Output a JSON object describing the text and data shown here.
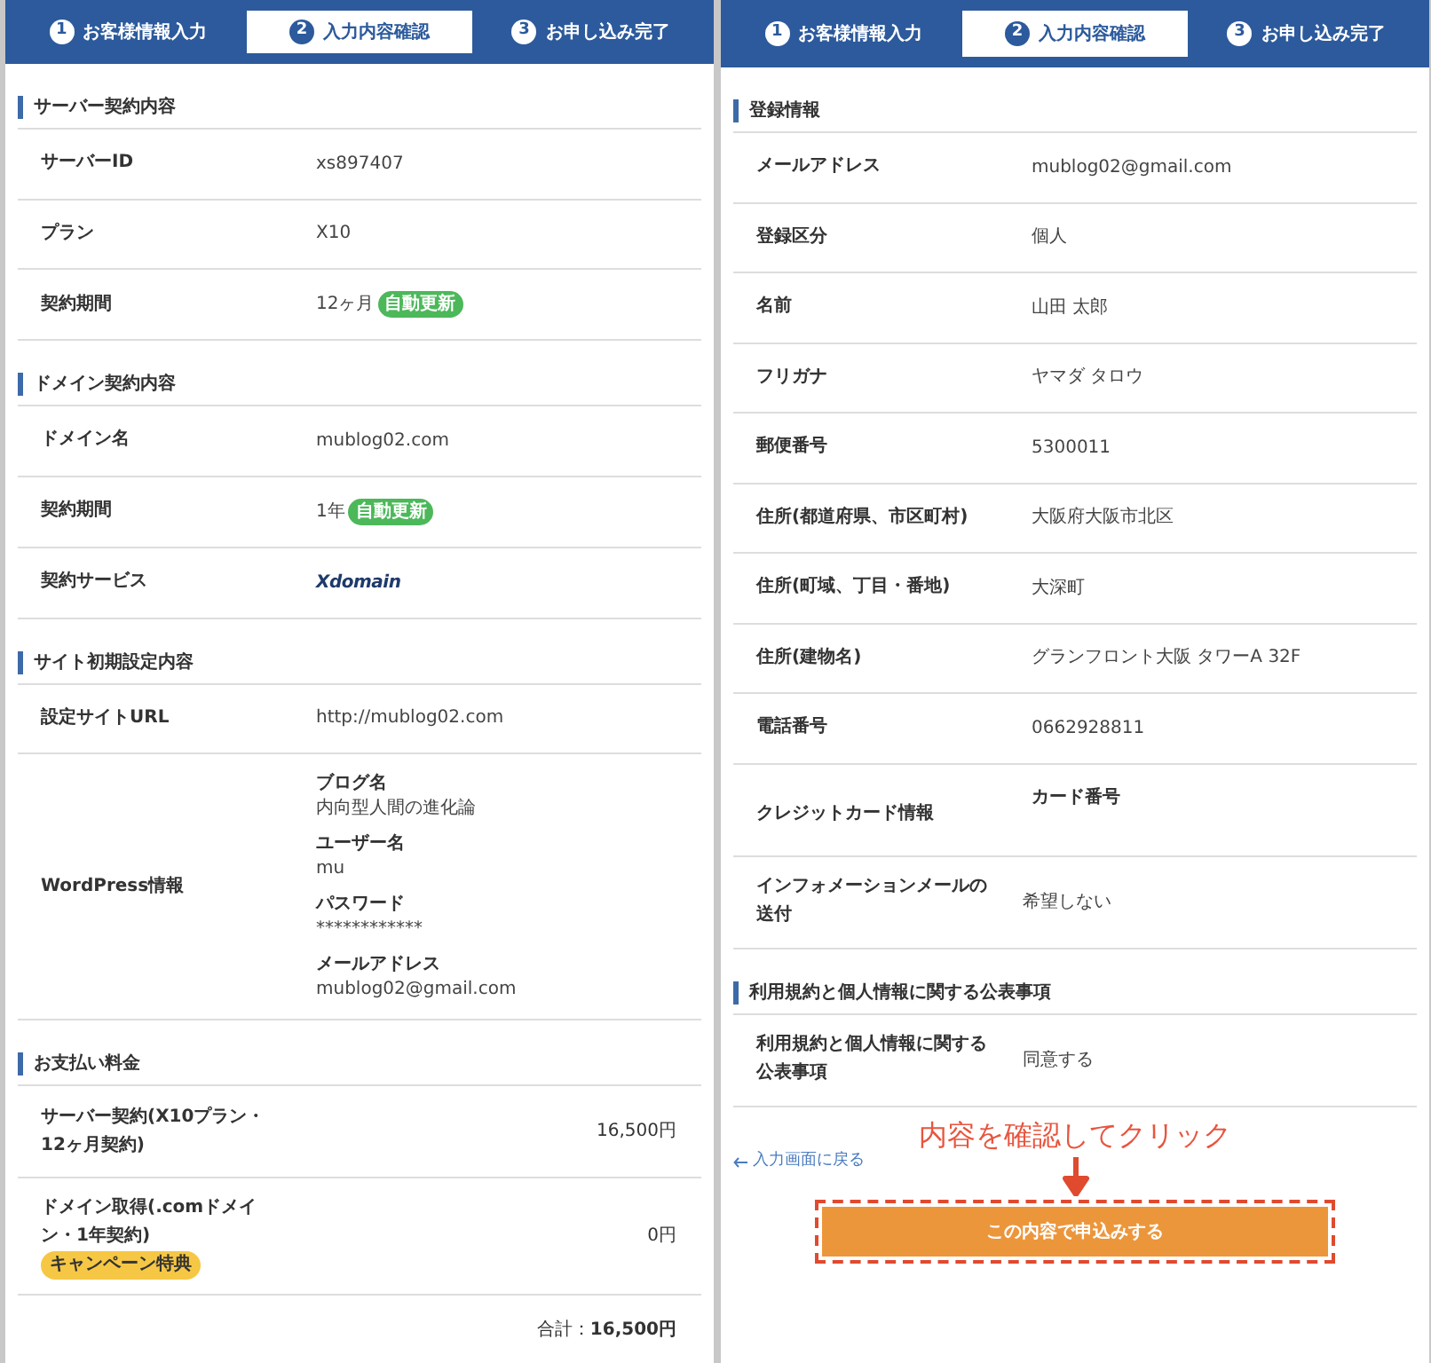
{
  "panels": [
    {
      "steps": [
        {
          "number": "1",
          "label": "お客様情報入力",
          "selected": false
        },
        {
          "number": "2",
          "label": "入力内容確認",
          "selected": true
        },
        {
          "number": "3",
          "label": "お申し込み完了",
          "selected": false
        }
      ],
      "sections": [
        {
          "title": "サーバー契約内容",
          "rows": [
            {
              "kind": "text",
              "label": "サーバーID",
              "value": "xs897407"
            },
            {
              "kind": "text",
              "label": "プラン",
              "value": "X10"
            },
            {
              "kind": "badge",
              "label": "契約期間",
              "value": "12ヶ月",
              "badge": "自動更新"
            }
          ]
        },
        {
          "title": "ドメイン契約内容",
          "rows": [
            {
              "kind": "text",
              "label": "ドメイン名",
              "value": "mublog02.com"
            },
            {
              "kind": "badge",
              "label": "契約期間",
              "value": "1年",
              "badge": "自動更新"
            },
            {
              "kind": "logo",
              "label": "契約サービス",
              "value": "Xdomain"
            }
          ]
        },
        {
          "title": "サイト初期設定内容",
          "rows": [
            {
              "kind": "text",
              "label": "設定サイトURL",
              "value": "http://mublog02.com"
            },
            {
              "kind": "fields",
              "label": "WordPress情報",
              "fields": [
                {
                  "label": "ブログ名",
                  "value": "内向型人間の進化論"
                },
                {
                  "label": "ユーザー名",
                  "value": "mu"
                },
                {
                  "label": "パスワード",
                  "value": "************"
                },
                {
                  "label": "メールアドレス",
                  "value": "mublog02@gmail.com"
                }
              ]
            }
          ]
        },
        {
          "title": "お支払い料金",
          "rows": [
            {
              "kind": "price",
              "label": "サーバー契約(X10プラン・12ヶ月契約)",
              "value": "16,500円"
            },
            {
              "kind": "price",
              "label": "ドメイン取得(.comドメイン・1年契約)",
              "badge": "キャンペーン特典",
              "value": "0円"
            }
          ],
          "total": "合計：**16,500円**"
        }
      ]
    },
    {
      "steps": [
        {
          "number": "1",
          "label": "お客様情報入力",
          "selected": false
        },
        {
          "number": "2",
          "label": "入力内容確認",
          "selected": true
        },
        {
          "number": "3",
          "label": "お申し込み完了",
          "selected": false
        }
      ],
      "sections": [
        {
          "title": "登録情報",
          "rows": [
            {
              "kind": "text",
              "label": "メールアドレス",
              "value": "mublog02@gmail.com"
            },
            {
              "kind": "text",
              "label": "登録区分",
              "value": "個人"
            },
            {
              "kind": "text",
              "label": "名前",
              "value": "山田 太郎"
            },
            {
              "kind": "text",
              "label": "フリガナ",
              "value": "ヤマダ タロウ"
            },
            {
              "kind": "text",
              "label": "郵便番号",
              "value": "5300011"
            },
            {
              "kind": "text",
              "label": "住所(都道府県、市区町村)",
              "value": "大阪府大阪市北区"
            },
            {
              "kind": "text",
              "label": "住所(町域、丁目・番地)",
              "value": "大深町"
            },
            {
              "kind": "text",
              "label": "住所(建物名)",
              "value": "グランフロント大阪 タワーA 32F"
            },
            {
              "kind": "text",
              "label": "電話番号",
              "value": "0662928811"
            },
            {
              "kind": "card",
              "label": "クレジットカード情報",
              "fields": [
                {
                  "label": "カード番号"
                }
              ]
            },
            {
              "kind": "tall",
              "label": "インフォメーションメールの送付",
              "value": "希望しない"
            }
          ]
        },
        {
          "title": "利用規約と個人情報に関する公表事項",
          "rows": [
            {
              "kind": "tall",
              "label": "利用規約と個人情報に関する公表事項",
              "value": "同意する"
            }
          ]
        }
      ],
      "back_link": "入力画面に戻る",
      "annotation": "内容を確認してクリック",
      "submit_button": "この内容で申込みする"
    }
  ]
}
